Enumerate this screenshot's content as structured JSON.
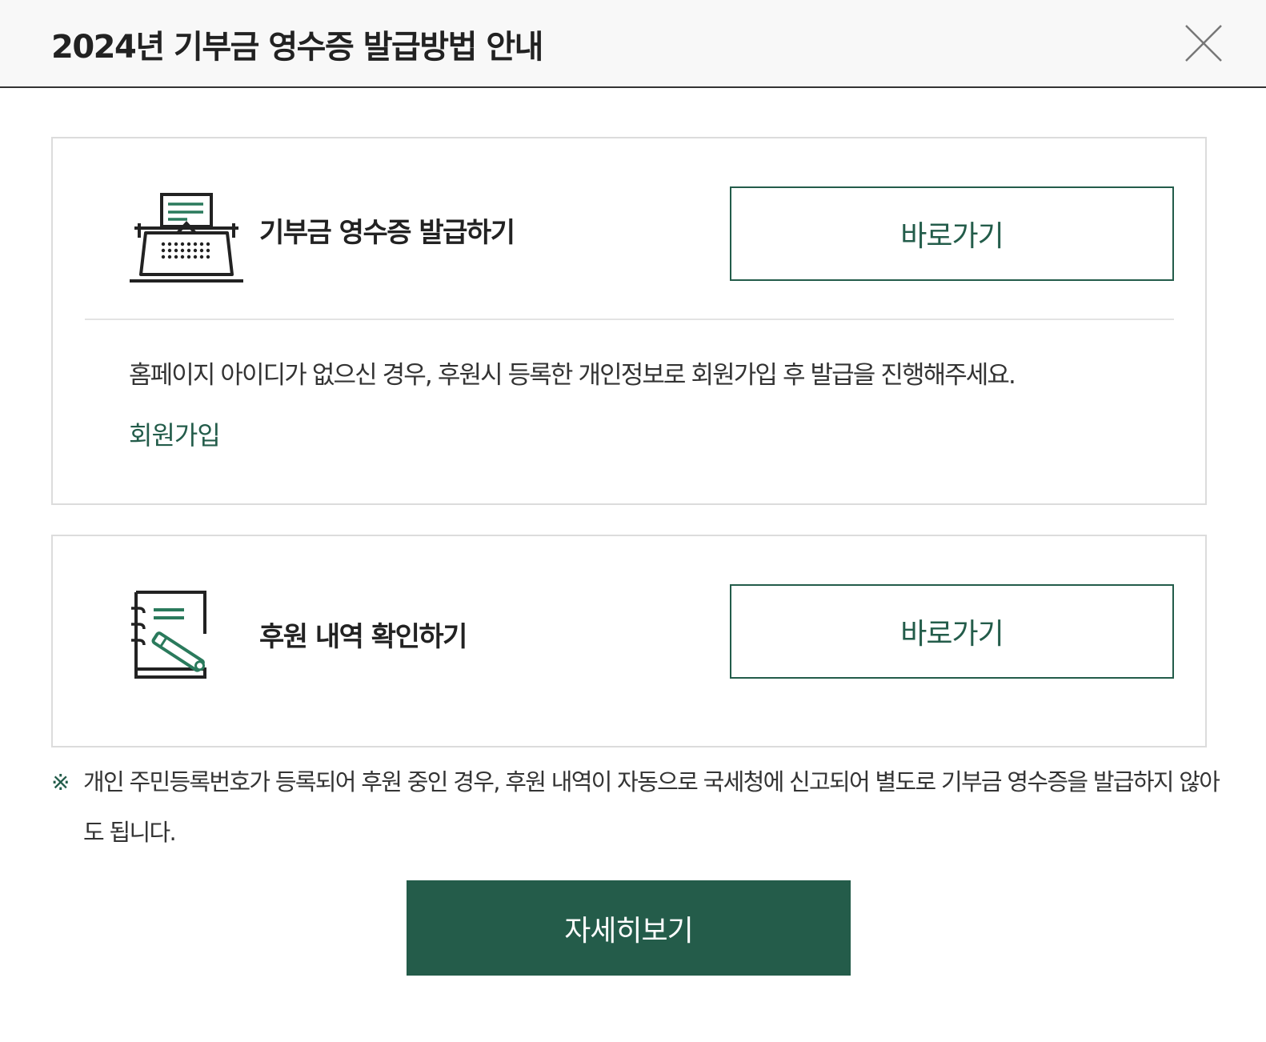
{
  "modal": {
    "title": "2024년 기부금 영수증 발급방법 안내",
    "close_icon": "close-x-icon"
  },
  "receipt_panel": {
    "icon": "typewriter-icon",
    "label": "기부금 영수증 발급하기",
    "button_label": "바로가기",
    "description": "홈페이지 아이디가 없으신 경우, 후원시 등록한 개인정보로 회원가입 후 발급을 진행해주세요.",
    "signup_link": "회원가입"
  },
  "history_panel": {
    "icon": "notebook-pencil-icon",
    "label": "후원 내역 확인하기",
    "button_label": "바로가기"
  },
  "notice": {
    "mark": "※",
    "text": "개인 주민등록번호가 등록되어 후원 중인 경우, 후원 내역이 자동으로 국세청에 신고되어 별도로 기부금 영수증을 발급하지 않아도 됩니다."
  },
  "detail_button": "자세히보기",
  "colors": {
    "accent": "#245c4a",
    "border": "#dcdcdc",
    "header_bg": "#f8f8f8"
  }
}
